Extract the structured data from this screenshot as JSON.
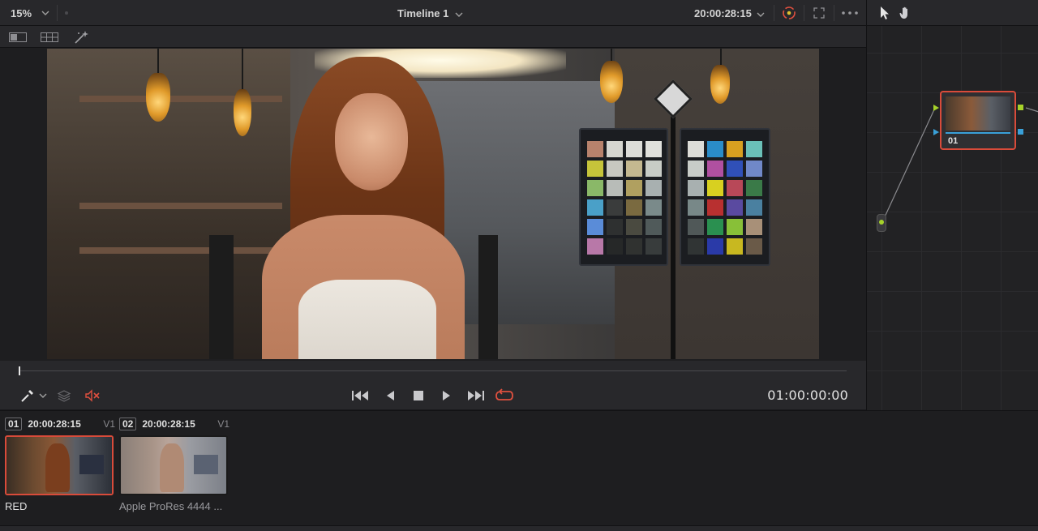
{
  "topbar": {
    "zoom": "15%",
    "timeline_title": "Timeline 1",
    "timecode": "20:00:28:15",
    "icons": [
      "chevron-down-icon",
      "color-wheel-icon",
      "fullscreen-icon",
      "more-icon",
      "pointer-icon",
      "hand-icon"
    ]
  },
  "toolbar2": {
    "icons": [
      "split-view-icon",
      "gallery-view-icon",
      "magic-wand-icon"
    ]
  },
  "viewer": {
    "image_subject": "frame-preview"
  },
  "transport": {
    "timecode": "01:00:00:00",
    "icons": [
      "eyedropper-icon",
      "layers-icon",
      "mute-icon",
      "jump-start-icon",
      "play-reverse-icon",
      "stop-icon",
      "play-icon",
      "jump-end-icon",
      "loop-icon"
    ],
    "accent_red": "#e0503f"
  },
  "nodes": {
    "node_label": "01",
    "colors": {
      "selected_border": "#d94b3a",
      "port_green": "#a6d22a",
      "port_blue": "#3aa0d8"
    }
  },
  "clips": [
    {
      "number": "01",
      "timecode": "20:00:28:15",
      "track": "V1",
      "label": "RED",
      "selected": true
    },
    {
      "number": "02",
      "timecode": "20:00:28:15",
      "track": "V1",
      "label": "Apple ProRes 4444 ...",
      "selected": false
    }
  ]
}
